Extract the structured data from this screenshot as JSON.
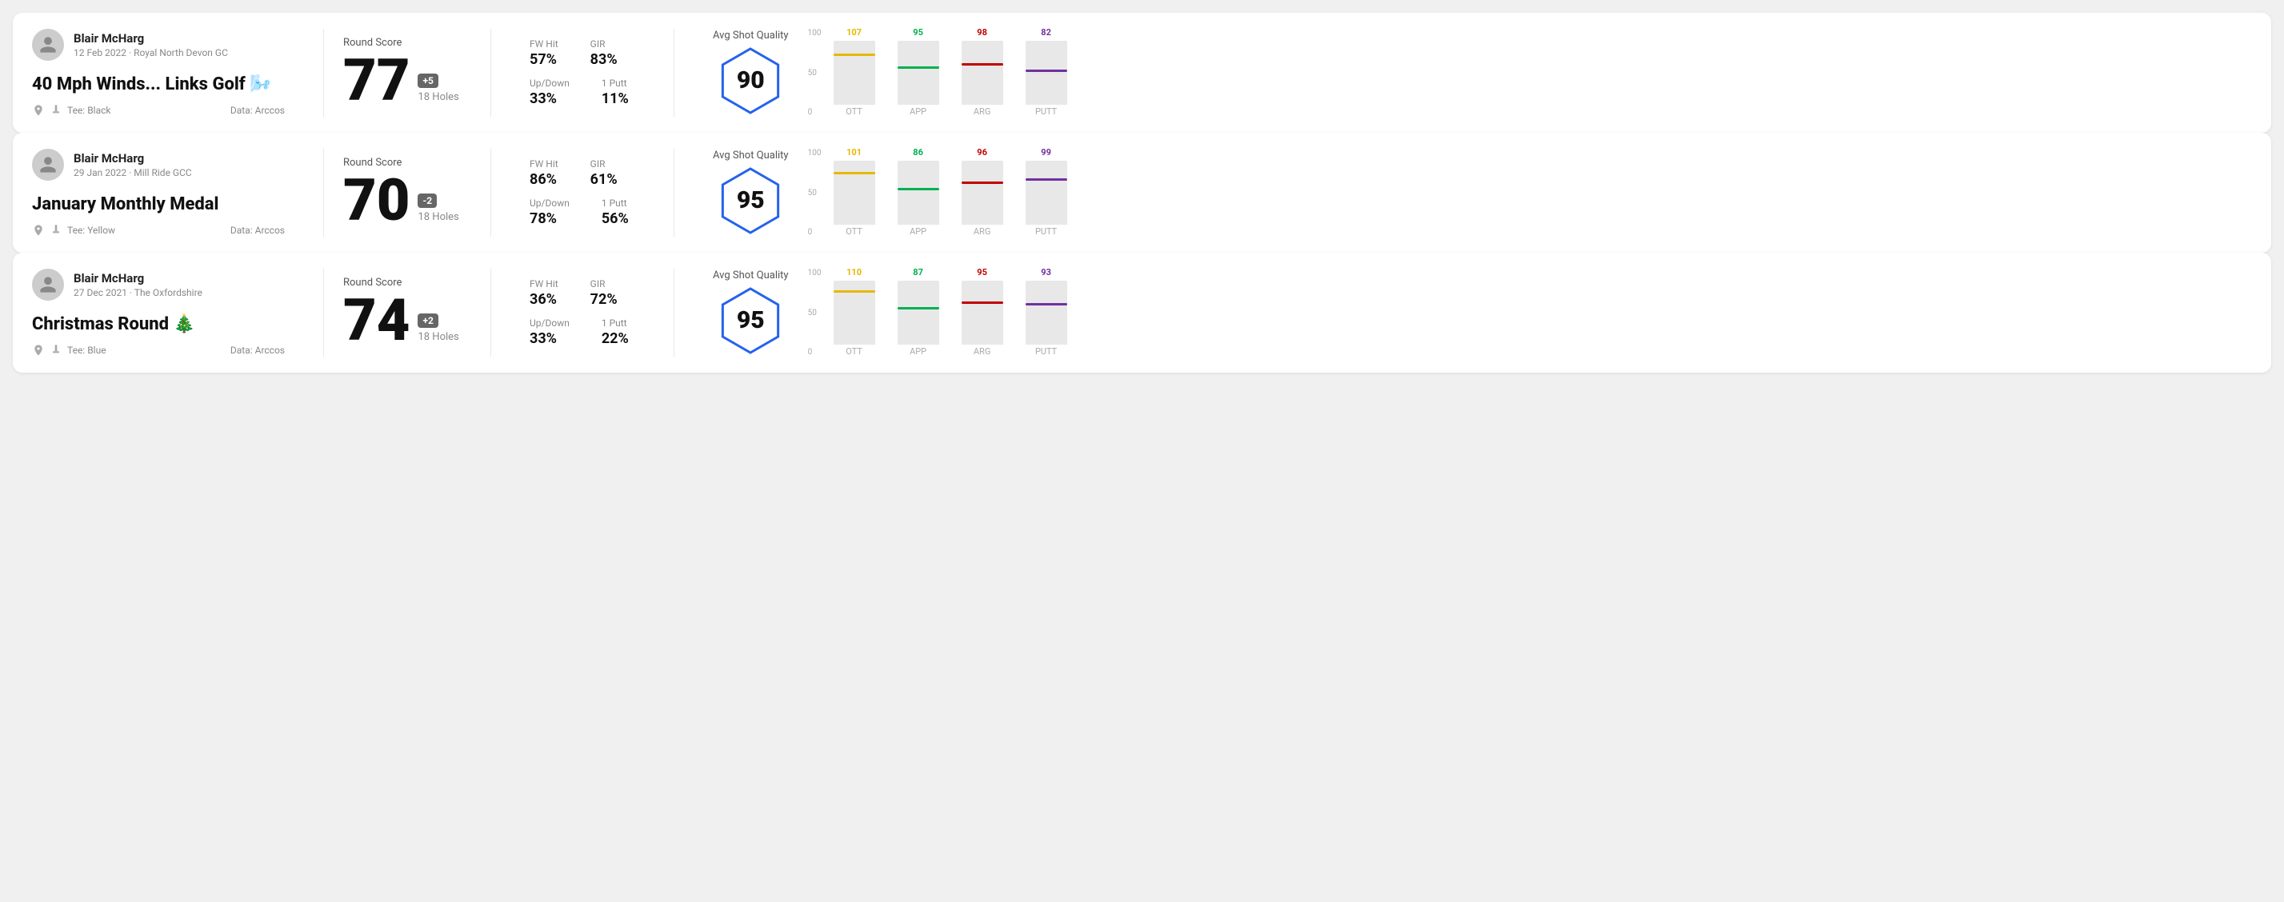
{
  "rounds": [
    {
      "id": "round1",
      "player": "Blair McHarg",
      "date": "12 Feb 2022",
      "course": "Royal North Devon GC",
      "title": "40 Mph Winds... Links Golf 🌬️",
      "tee": "Black",
      "data_source": "Data: Arccos",
      "score": 77,
      "score_diff": "+5",
      "score_diff_type": "plus",
      "holes": "18 Holes",
      "fw_hit": "57%",
      "gir": "83%",
      "up_down": "33%",
      "one_putt": "11%",
      "avg_shot_quality": 90,
      "chart": {
        "ott": {
          "value": 107,
          "color": "#e6b800",
          "pct": 80
        },
        "app": {
          "value": 95,
          "color": "#00b050",
          "pct": 60
        },
        "arg": {
          "value": 98,
          "color": "#c00000",
          "pct": 65
        },
        "putt": {
          "value": 82,
          "color": "#7030a0",
          "pct": 55
        }
      }
    },
    {
      "id": "round2",
      "player": "Blair McHarg",
      "date": "29 Jan 2022",
      "course": "Mill Ride GCC",
      "title": "January Monthly Medal",
      "tee": "Yellow",
      "data_source": "Data: Arccos",
      "score": 70,
      "score_diff": "-2",
      "score_diff_type": "minus",
      "holes": "18 Holes",
      "fw_hit": "86%",
      "gir": "61%",
      "up_down": "78%",
      "one_putt": "56%",
      "avg_shot_quality": 95,
      "chart": {
        "ott": {
          "value": 101,
          "color": "#e6b800",
          "pct": 82
        },
        "app": {
          "value": 86,
          "color": "#00b050",
          "pct": 58
        },
        "arg": {
          "value": 96,
          "color": "#c00000",
          "pct": 68
        },
        "putt": {
          "value": 99,
          "color": "#7030a0",
          "pct": 72
        }
      }
    },
    {
      "id": "round3",
      "player": "Blair McHarg",
      "date": "27 Dec 2021",
      "course": "The Oxfordshire",
      "title": "Christmas Round 🎄",
      "tee": "Blue",
      "data_source": "Data: Arccos",
      "score": 74,
      "score_diff": "+2",
      "score_diff_type": "plus",
      "holes": "18 Holes",
      "fw_hit": "36%",
      "gir": "72%",
      "up_down": "33%",
      "one_putt": "22%",
      "avg_shot_quality": 95,
      "chart": {
        "ott": {
          "value": 110,
          "color": "#e6b800",
          "pct": 85
        },
        "app": {
          "value": 87,
          "color": "#00b050",
          "pct": 59
        },
        "arg": {
          "value": 95,
          "color": "#c00000",
          "pct": 67
        },
        "putt": {
          "value": 93,
          "color": "#7030a0",
          "pct": 65
        }
      }
    }
  ],
  "chart_labels": {
    "ott": "OTT",
    "app": "APP",
    "arg": "ARG",
    "putt": "PUTT"
  },
  "chart_y_labels": [
    "100",
    "50",
    "0"
  ],
  "avg_shot_quality_label": "Avg Shot Quality"
}
